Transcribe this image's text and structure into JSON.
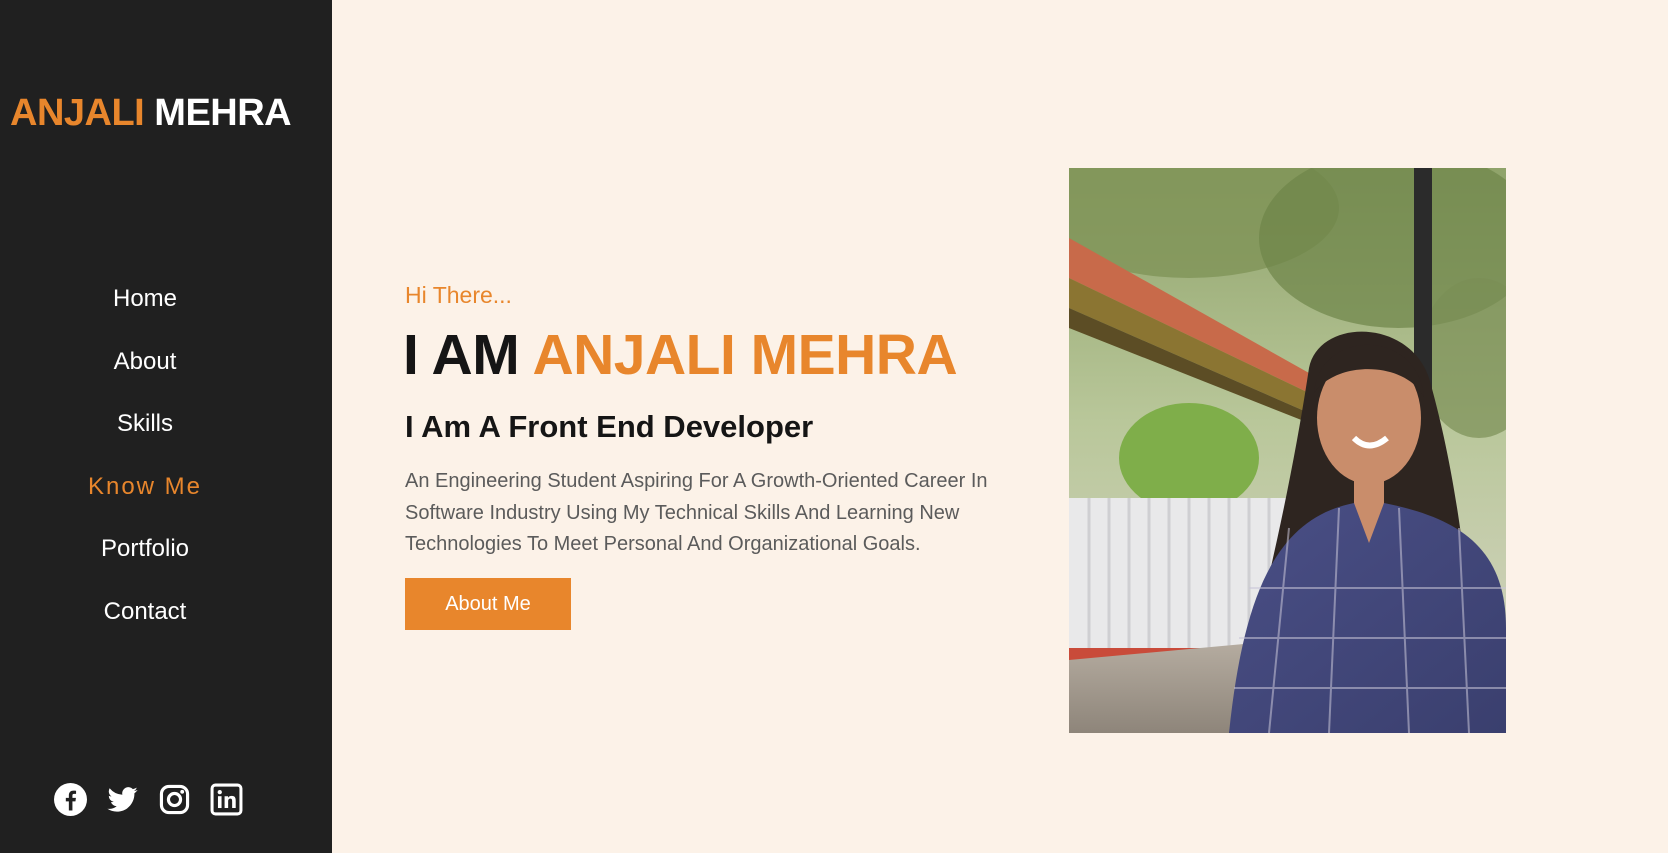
{
  "brand": {
    "first": "ANJALI",
    "last": "MEHRA"
  },
  "nav": {
    "items": [
      {
        "label": "Home"
      },
      {
        "label": "About"
      },
      {
        "label": "Skills"
      },
      {
        "label": "Know Me",
        "active": true
      },
      {
        "label": "Portfolio"
      },
      {
        "label": "Contact"
      }
    ]
  },
  "social": [
    "facebook-icon",
    "twitter-icon",
    "instagram-icon",
    "linkedin-icon"
  ],
  "hero": {
    "greeting": "Hi There...",
    "headline_prefix": "I AM",
    "headline_name": "ANJALI MEHRA",
    "subhead": "I Am A Front End Developer",
    "description": "An Engineering Student Aspiring For A Growth-Oriented Career In Software Industry Using My Technical Skills And Learning New Technologies To Meet Personal And Organizational Goals.",
    "cta_label": "About Me"
  },
  "colors": {
    "accent": "#e8862c",
    "sidebar_bg": "#202020",
    "page_bg": "#fcf2e8"
  }
}
